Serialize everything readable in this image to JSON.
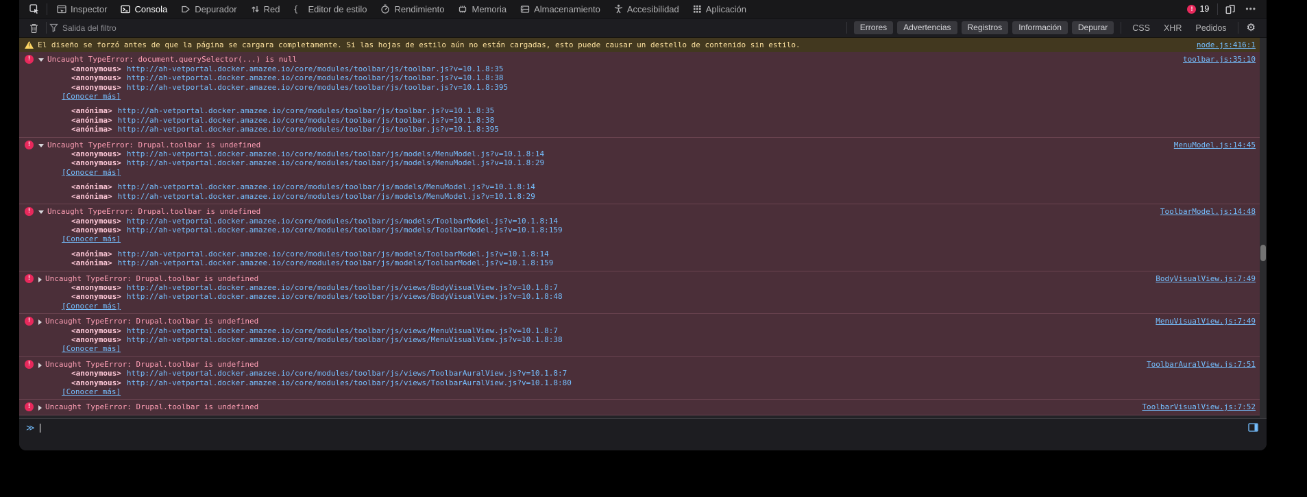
{
  "tabs_bar": {
    "tabs": [
      {
        "label": "Inspector",
        "icon": "inspector-icon",
        "active": false
      },
      {
        "label": "Consola",
        "icon": "console-icon",
        "active": true
      },
      {
        "label": "Depurador",
        "icon": "debugger-icon",
        "active": false
      },
      {
        "label": "Red",
        "icon": "network-icon",
        "active": false
      },
      {
        "label": "Editor de estilo",
        "icon": "style-editor-icon",
        "active": false
      },
      {
        "label": "Rendimiento",
        "icon": "performance-icon",
        "active": false
      },
      {
        "label": "Memoria",
        "icon": "memory-icon",
        "active": false
      },
      {
        "label": "Almacenamiento",
        "icon": "storage-icon",
        "active": false
      },
      {
        "label": "Accesibilidad",
        "icon": "accessibility-icon",
        "active": false
      },
      {
        "label": "Aplicación",
        "icon": "application-icon",
        "active": false
      }
    ],
    "error_count": "19",
    "meatball": "•••"
  },
  "filter_bar": {
    "placeholder": "Salida del filtro",
    "chips": [
      "Errores",
      "Advertencias",
      "Registros",
      "Información",
      "Depurar"
    ],
    "text_buttons": [
      "CSS",
      "XHR",
      "Pedidos"
    ]
  },
  "console": {
    "prompt": "≫",
    "messages": [
      {
        "type": "warning",
        "text": "El diseño se forzó antes de que la página se cargara completamente. Si las hojas de estilo aún no están cargadas, esto puede causar un destello de contenido sin estilo.",
        "source_link": "node.js:416:1"
      },
      {
        "type": "error",
        "expanded": true,
        "text": "Uncaught TypeError: document.querySelector(...) is null",
        "source_link": "toolbar.js:35:10",
        "frames": [
          {
            "fn": "<anonymous>",
            "url": "http://ah-vetportal.docker.amazee.io/core/modules/toolbar/js/toolbar.js?v=10.1.8:35"
          },
          {
            "fn": "<anonymous>",
            "url": "http://ah-vetportal.docker.amazee.io/core/modules/toolbar/js/toolbar.js?v=10.1.8:38"
          },
          {
            "fn": "<anonymous>",
            "url": "http://ah-vetportal.docker.amazee.io/core/modules/toolbar/js/toolbar.js?v=10.1.8:395"
          }
        ],
        "learn_more": "[Conocer más]",
        "async_frames": [
          {
            "fn": "<anónima>",
            "url": "http://ah-vetportal.docker.amazee.io/core/modules/toolbar/js/toolbar.js?v=10.1.8:35"
          },
          {
            "fn": "<anónima>",
            "url": "http://ah-vetportal.docker.amazee.io/core/modules/toolbar/js/toolbar.js?v=10.1.8:38"
          },
          {
            "fn": "<anónima>",
            "url": "http://ah-vetportal.docker.amazee.io/core/modules/toolbar/js/toolbar.js?v=10.1.8:395"
          }
        ]
      },
      {
        "type": "error",
        "expanded": true,
        "text": "Uncaught TypeError: Drupal.toolbar is undefined",
        "source_link": "MenuModel.js:14:45",
        "frames": [
          {
            "fn": "<anonymous>",
            "url": "http://ah-vetportal.docker.amazee.io/core/modules/toolbar/js/models/MenuModel.js?v=10.1.8:14"
          },
          {
            "fn": "<anonymous>",
            "url": "http://ah-vetportal.docker.amazee.io/core/modules/toolbar/js/models/MenuModel.js?v=10.1.8:29"
          }
        ],
        "learn_more": "[Conocer más]",
        "async_frames": [
          {
            "fn": "<anónima>",
            "url": "http://ah-vetportal.docker.amazee.io/core/modules/toolbar/js/models/MenuModel.js?v=10.1.8:14"
          },
          {
            "fn": "<anónima>",
            "url": "http://ah-vetportal.docker.amazee.io/core/modules/toolbar/js/models/MenuModel.js?v=10.1.8:29"
          }
        ]
      },
      {
        "type": "error",
        "expanded": true,
        "text": "Uncaught TypeError: Drupal.toolbar is undefined",
        "source_link": "ToolbarModel.js:14:48",
        "frames": [
          {
            "fn": "<anonymous>",
            "url": "http://ah-vetportal.docker.amazee.io/core/modules/toolbar/js/models/ToolbarModel.js?v=10.1.8:14"
          },
          {
            "fn": "<anonymous>",
            "url": "http://ah-vetportal.docker.amazee.io/core/modules/toolbar/js/models/ToolbarModel.js?v=10.1.8:159"
          }
        ],
        "learn_more": "[Conocer más]",
        "async_frames": [
          {
            "fn": "<anónima>",
            "url": "http://ah-vetportal.docker.amazee.io/core/modules/toolbar/js/models/ToolbarModel.js?v=10.1.8:14"
          },
          {
            "fn": "<anónima>",
            "url": "http://ah-vetportal.docker.amazee.io/core/modules/toolbar/js/models/ToolbarModel.js?v=10.1.8:159"
          }
        ]
      },
      {
        "type": "error",
        "expanded": false,
        "text": "Uncaught TypeError: Drupal.toolbar is undefined",
        "source_link": "BodyVisualView.js:7:49",
        "frames": [
          {
            "fn": "<anonymous>",
            "url": "http://ah-vetportal.docker.amazee.io/core/modules/toolbar/js/views/BodyVisualView.js?v=10.1.8:7"
          },
          {
            "fn": "<anonymous>",
            "url": "http://ah-vetportal.docker.amazee.io/core/modules/toolbar/js/views/BodyVisualView.js?v=10.1.8:48"
          }
        ],
        "learn_more": "[Conocer más]",
        "async_frames": []
      },
      {
        "type": "error",
        "expanded": false,
        "text": "Uncaught TypeError: Drupal.toolbar is undefined",
        "source_link": "MenuVisualView.js:7:49",
        "frames": [
          {
            "fn": "<anonymous>",
            "url": "http://ah-vetportal.docker.amazee.io/core/modules/toolbar/js/views/MenuVisualView.js?v=10.1.8:7"
          },
          {
            "fn": "<anonymous>",
            "url": "http://ah-vetportal.docker.amazee.io/core/modules/toolbar/js/views/MenuVisualView.js?v=10.1.8:38"
          }
        ],
        "learn_more": "[Conocer más]",
        "async_frames": []
      },
      {
        "type": "error",
        "expanded": false,
        "text": "Uncaught TypeError: Drupal.toolbar is undefined",
        "source_link": "ToolbarAuralView.js:7:51",
        "frames": [
          {
            "fn": "<anonymous>",
            "url": "http://ah-vetportal.docker.amazee.io/core/modules/toolbar/js/views/ToolbarAuralView.js?v=10.1.8:7"
          },
          {
            "fn": "<anonymous>",
            "url": "http://ah-vetportal.docker.amazee.io/core/modules/toolbar/js/views/ToolbarAuralView.js?v=10.1.8:80"
          }
        ],
        "learn_more": "[Conocer más]",
        "async_frames": []
      },
      {
        "type": "error",
        "expanded": false,
        "text": "Uncaught TypeError: Drupal.toolbar is undefined",
        "source_link": "ToolbarVisualView.js:7:52",
        "frames": [],
        "learn_more": "",
        "async_frames": []
      }
    ]
  },
  "colors": {
    "accent_link": "#75bfff",
    "error_text": "#ff9fb5",
    "error_background": "#4b2f39",
    "error_icon": "#e8295c",
    "warning_background": "#42381f",
    "warning_text": "#fce19f",
    "toolbar_background": "#18181a",
    "console_background": "#232327",
    "chip_background": "#38383d"
  }
}
